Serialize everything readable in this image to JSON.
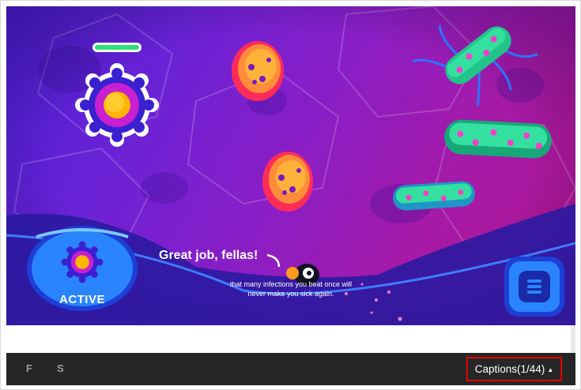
{
  "game": {
    "speech_main": "Great job, fellas!",
    "subtitle": "that many infections you beat once will never make you sick again.",
    "active_pod_label": "ACTIVE",
    "player_health": 1.0
  },
  "controls": {
    "fullscreen_label": "F",
    "sound_label": "S",
    "captions_label": "Captions(1/44)",
    "captions_caret": "▲"
  },
  "colors": {
    "background_left": "#4a1fd6",
    "background_right": "#b0158e",
    "health": "#2ee077",
    "pod": "#2a84ff",
    "captions_highlight": "#e00000",
    "control_bar": "#262626"
  },
  "icons": {
    "menu": "menu-icon",
    "caret": "caret-up-icon"
  }
}
